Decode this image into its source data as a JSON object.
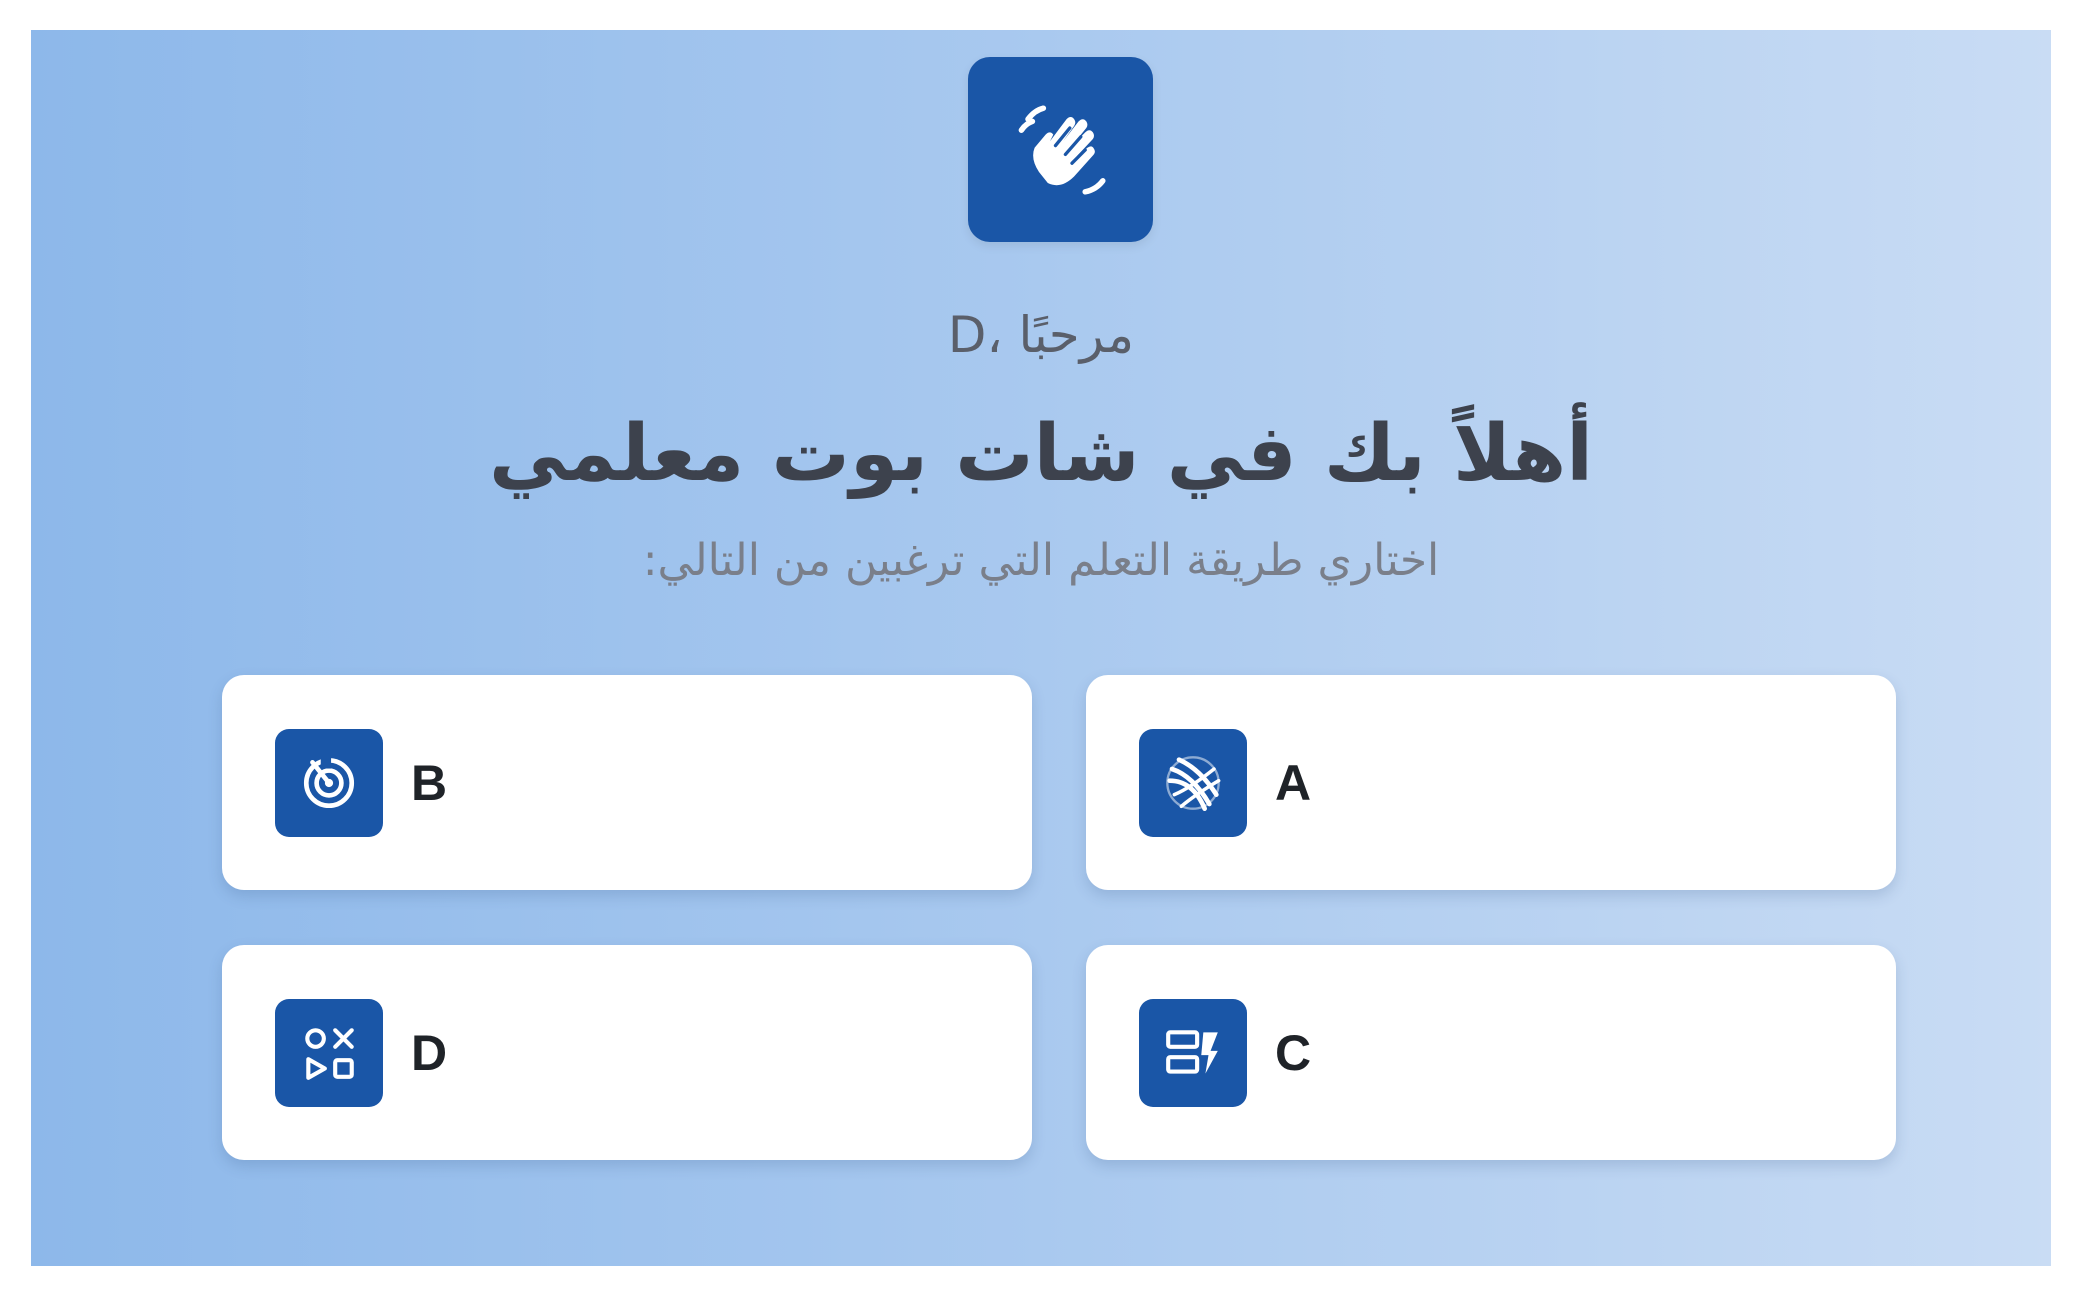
{
  "header": {
    "icon": "waving-hand-icon",
    "greeting": "مرحبًا ،D",
    "title": "أهلاً بك في شات بوت معلمي",
    "subtitle": "اختاري طريقة التعلم التي ترغبين من التالي:"
  },
  "options": [
    {
      "label": "A",
      "icon": "swirl-icon"
    },
    {
      "label": "B",
      "icon": "target-icon"
    },
    {
      "label": "C",
      "icon": "flash-cards-icon"
    },
    {
      "label": "D",
      "icon": "game-shapes-icon"
    }
  ],
  "colors": {
    "accent": "#1a56a7",
    "background_start": "#8db8ea",
    "background_end": "#c9dcf4",
    "card": "#ffffff"
  }
}
